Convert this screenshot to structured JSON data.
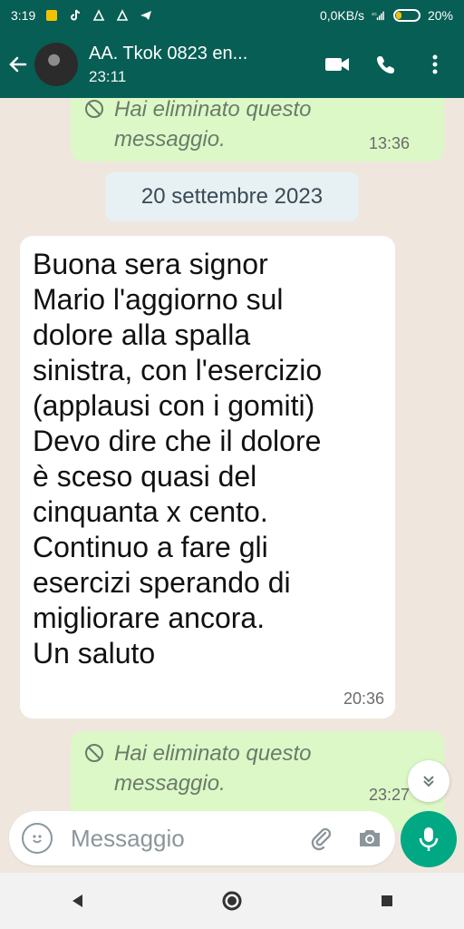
{
  "status_bar": {
    "time": "3:19",
    "speed": "0,0KB/s",
    "battery": "20%"
  },
  "header": {
    "title": "AA. Tkok 0823 en...",
    "subtitle": "23:11"
  },
  "messages": [
    {
      "type": "deleted",
      "direction": "out",
      "text_line1": "Hai eliminato questo",
      "text_line2": "messaggio.",
      "time": "13:36"
    },
    {
      "type": "date",
      "text": "20 settembre 2023"
    },
    {
      "type": "text",
      "direction": "in",
      "lines": [
        "Buona sera signor",
        "Mario l'aggiorno sul",
        "dolore alla spalla",
        "sinistra, con l'esercizio",
        "(applausi con i gomiti)",
        "Devo dire che il dolore",
        "è sceso quasi del",
        "cinquanta x cento.",
        "Continuo a fare gli",
        "esercizi sperando di",
        "migliorare ancora.",
        "Un saluto"
      ],
      "time": "20:36"
    },
    {
      "type": "deleted",
      "direction": "out",
      "text_line1": "Hai eliminato questo",
      "text_line2": "messaggio.",
      "time": "23:27"
    }
  ],
  "composer": {
    "placeholder": "Messaggio"
  },
  "colors": {
    "header": "#075e54",
    "outgoing_bubble": "#dcf8c6",
    "incoming_bubble": "#ffffff",
    "accent": "#00a884",
    "chat_background": "#efe7de"
  }
}
